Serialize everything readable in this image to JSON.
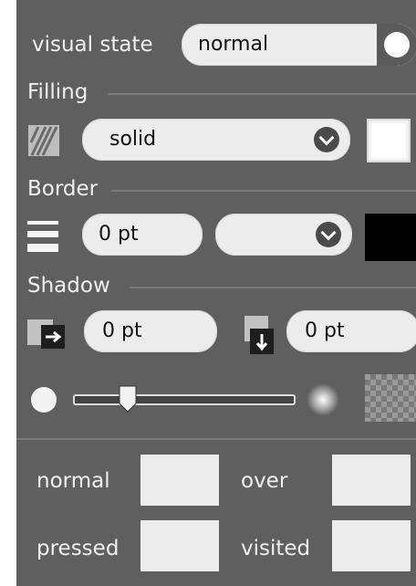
{
  "visual_state": {
    "label": "visual state",
    "value": "normal"
  },
  "filling": {
    "heading": "Filling",
    "pattern_value": "solid",
    "color": "#ffffff",
    "icon": "fill-pattern-icon"
  },
  "border": {
    "heading": "Border",
    "width_value": "0 pt",
    "style_value": "",
    "color": "#000000",
    "icon": "border-lines-icon"
  },
  "shadow": {
    "heading": "Shadow",
    "x_value": "0 pt",
    "y_value": "0 pt",
    "x_icon": "shadow-offset-x-icon",
    "y_icon": "shadow-offset-y-icon",
    "blur_level": 0.25,
    "color_icon": "transparent-color-icon"
  },
  "states": {
    "normal": "normal",
    "over": "over",
    "pressed": "pressed",
    "visited": "visited"
  },
  "colors": {
    "panel": "#5f5f5f",
    "field": "#ececec",
    "divider": "#7a7a7a"
  }
}
